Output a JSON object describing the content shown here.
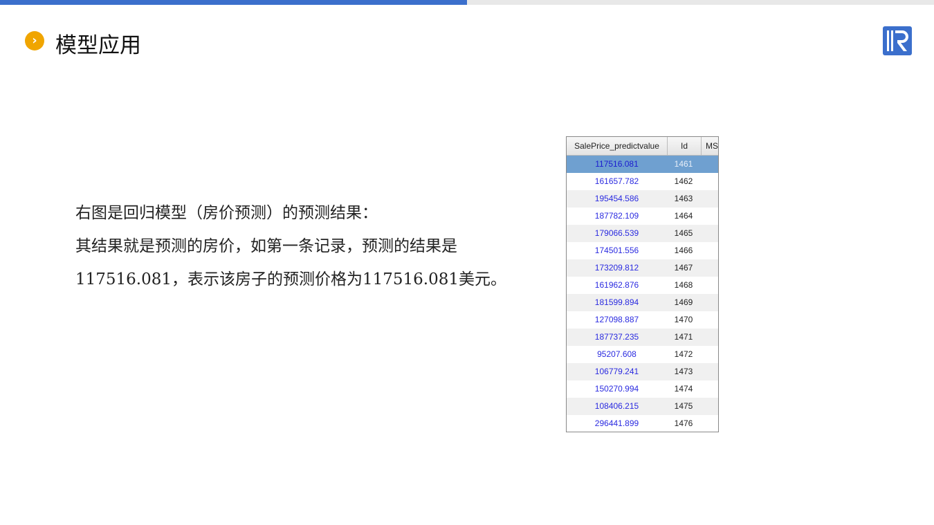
{
  "header": {
    "title": "模型应用",
    "accent": "#3b6fcc",
    "bullet_color": "#f0a500"
  },
  "body": {
    "lines": [
      "右图是回归模型（房价预测）的预测结果：",
      "其结果就是预测的房价，如第一条记录，预测的结果是",
      "117516.081，表示该房子的预测价格为117516.081美元。"
    ]
  },
  "table": {
    "columns": [
      "SalePrice_predictvalue",
      "Id",
      "MS"
    ],
    "rows": [
      [
        "117516.081",
        "1461"
      ],
      [
        "161657.782",
        "1462"
      ],
      [
        "195454.586",
        "1463"
      ],
      [
        "187782.109",
        "1464"
      ],
      [
        "179066.539",
        "1465"
      ],
      [
        "174501.556",
        "1466"
      ],
      [
        "173209.812",
        "1467"
      ],
      [
        "161962.876",
        "1468"
      ],
      [
        "181599.894",
        "1469"
      ],
      [
        "127098.887",
        "1470"
      ],
      [
        "187737.235",
        "1471"
      ],
      [
        "95207.608",
        "1472"
      ],
      [
        "106779.241",
        "1473"
      ],
      [
        "150270.994",
        "1474"
      ],
      [
        "108406.215",
        "1475"
      ],
      [
        "296441.899",
        "1476"
      ]
    ],
    "selected_row": 0
  }
}
